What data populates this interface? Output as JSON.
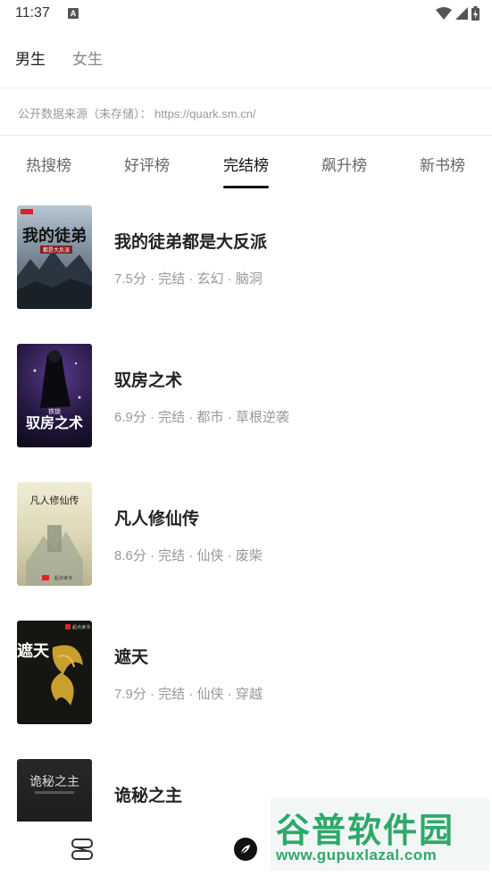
{
  "status_bar": {
    "time": "11:37",
    "notification_icon": "A"
  },
  "gender_tabs": [
    {
      "label": "男生",
      "active": true
    },
    {
      "label": "女生",
      "active": false
    }
  ],
  "source_notice": "公开数据来源（未存储）： https://quark.sm.cn/",
  "rank_tabs": [
    {
      "label": "热搜榜",
      "active": false
    },
    {
      "label": "好评榜",
      "active": false
    },
    {
      "label": "完结榜",
      "active": true
    },
    {
      "label": "飙升榜",
      "active": false
    },
    {
      "label": "新书榜",
      "active": false
    }
  ],
  "books": [
    {
      "title": "我的徒弟都是大反派",
      "meta": "7.5分 · 完结 · 玄幻 · 脑洞",
      "cover_text": "我的徒弟",
      "cover_sub": "都是大反派"
    },
    {
      "title": "驭房之术",
      "meta": "6.9分 · 完结 · 都市 · 草根逆袭",
      "cover_text": "驭房之术",
      "cover_sub": "铁锁"
    },
    {
      "title": "凡人修仙传",
      "meta": "8.6分 · 完结 · 仙侠 · 废柴",
      "cover_text": "凡人修仙传",
      "cover_sub": "起点读书"
    },
    {
      "title": "遮天",
      "meta": "7.9分 · 完结 · 仙侠 · 穿越",
      "cover_text": "遮天",
      "cover_sub": "起点读书"
    },
    {
      "title": "诡秘之主",
      "meta": "",
      "cover_text": "诡秘之主",
      "cover_sub": ""
    }
  ],
  "bottom_nav": [
    {
      "icon": "bookshelf-icon"
    },
    {
      "icon": "compass-icon"
    },
    {
      "icon": "profile-icon"
    }
  ],
  "watermark": {
    "title": "谷普软件园",
    "url": "www.gupuxlazal.com"
  },
  "colors": {
    "accent": "#111111",
    "muted": "#999999",
    "watermark": "#2fa86a"
  }
}
